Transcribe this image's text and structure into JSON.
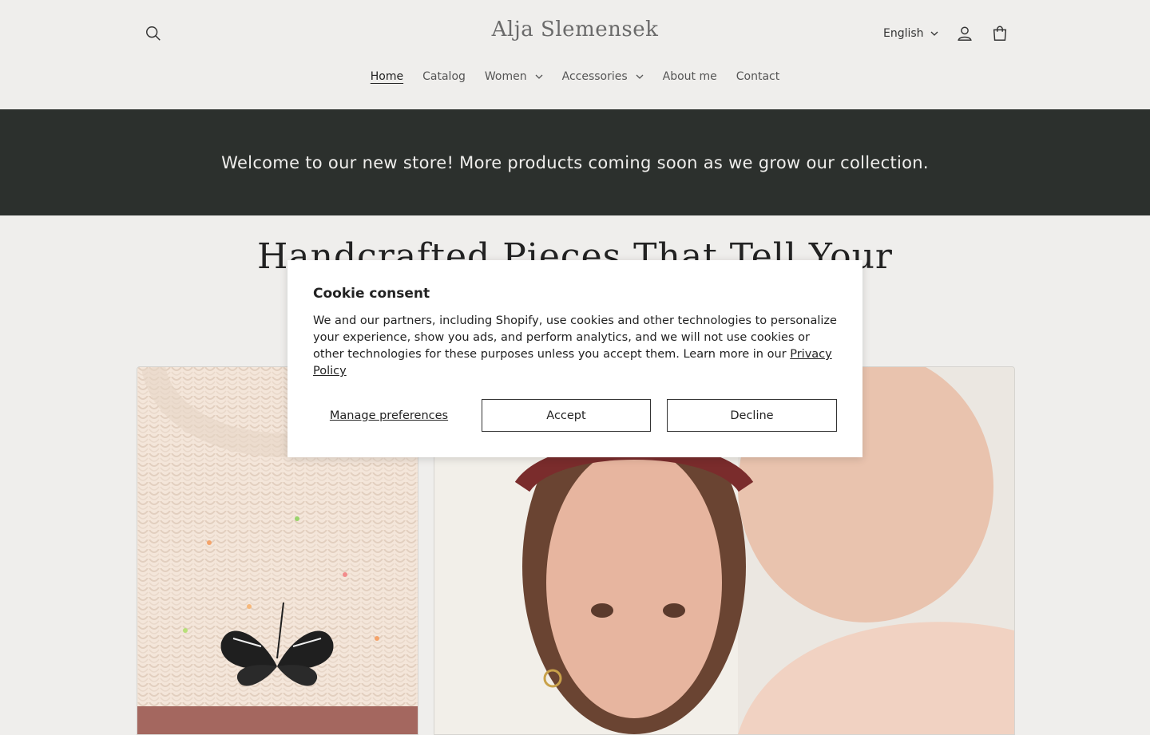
{
  "header": {
    "logo": "Alja Slemensek",
    "language": "English",
    "nav": [
      {
        "label": "Home",
        "active": true,
        "dropdown": false
      },
      {
        "label": "Catalog",
        "active": false,
        "dropdown": false
      },
      {
        "label": "Women",
        "active": false,
        "dropdown": true
      },
      {
        "label": "Accessories",
        "active": false,
        "dropdown": true
      },
      {
        "label": "About me",
        "active": false,
        "dropdown": false
      },
      {
        "label": "Contact",
        "active": false,
        "dropdown": false
      }
    ],
    "icons": [
      "search-icon",
      "account-icon",
      "cart-icon"
    ]
  },
  "banner": {
    "text": "Welcome to our new store! More products coming soon as we grow our collection.",
    "background": "#2c302d"
  },
  "hero": {
    "title": "Handcrafted Pieces That Tell Your"
  },
  "cookie": {
    "title": "Cookie consent",
    "body": "We and our partners, including Shopify, use cookies and other technologies to personalize your experience, show you ads, and perform analytics, and we will not use cookies or other technologies for these purposes unless you accept them. Learn more in our ",
    "policy_link": "Privacy Policy",
    "manage_label": "Manage preferences",
    "accept_label": "Accept",
    "decline_label": "Decline"
  },
  "colors": {
    "page_bg": "#efeeec",
    "banner_bg": "#2c302d",
    "text": "#222222"
  }
}
